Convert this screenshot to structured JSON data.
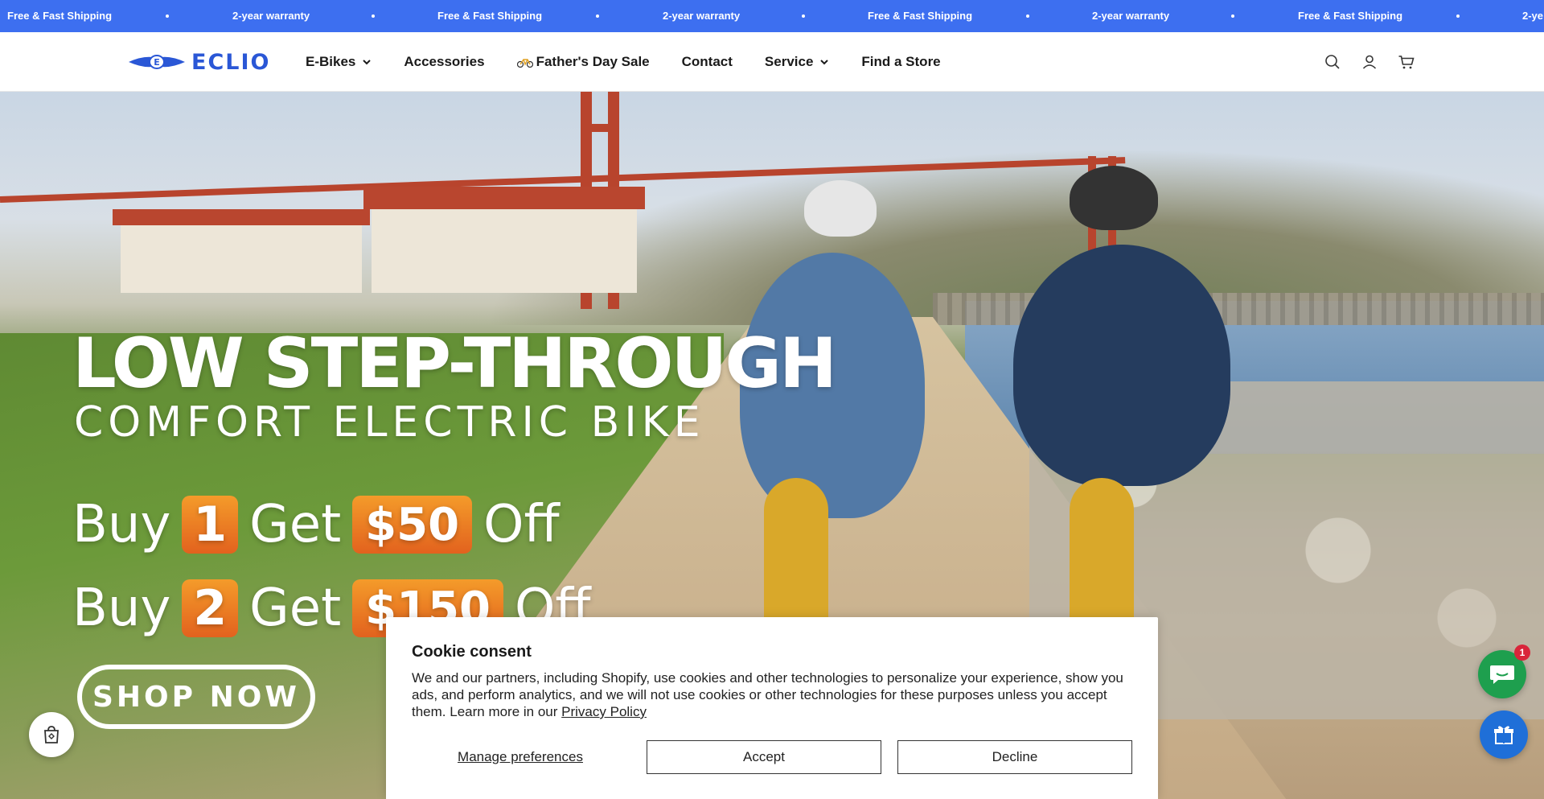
{
  "announcement": {
    "items": [
      "Free & Fast Shipping",
      "2-year warranty",
      "Free & Fast Shipping",
      "2-year warranty",
      "Free & Fast Shipping",
      "2-year warranty",
      "Free & Fast Shipping",
      "2-ye"
    ],
    "background": "#3d6ff0"
  },
  "header": {
    "logo_text": "ECLIO",
    "nav": [
      {
        "label": "E-Bikes",
        "has_dropdown": true
      },
      {
        "label": "Accessories",
        "has_dropdown": false
      },
      {
        "label": "Father's Day Sale",
        "has_dropdown": false,
        "icon": "bicycle-icon"
      },
      {
        "label": "Contact",
        "has_dropdown": false
      },
      {
        "label": "Service",
        "has_dropdown": true
      },
      {
        "label": "Find a Store",
        "has_dropdown": false
      }
    ],
    "icons": [
      "search-icon",
      "account-icon",
      "cart-icon"
    ]
  },
  "hero": {
    "title": "LOW STEP-THROUGH",
    "subtitle": "COMFORT ELECTRIC BIKE",
    "offer1": {
      "buy": "Buy",
      "qty": "1",
      "get": "Get",
      "amount": "$50",
      "off": "Off"
    },
    "offer2": {
      "buy": "Buy",
      "qty": "2",
      "get": "Get",
      "amount": "$150",
      "off": "Off"
    },
    "cta": "SHOP NOW",
    "badge_color": "#ef7d22"
  },
  "widgets": {
    "chat_badge_count": "1",
    "chat_color": "#1e9f4e",
    "gift_color": "#1f6fd8"
  },
  "cookie": {
    "title": "Cookie consent",
    "text": "We and our partners, including Shopify, use cookies and other technologies to personalize your experience, show you ads, and perform analytics, and we will not use cookies or other technologies for these purposes unless you accept them. Learn more in our ",
    "link_text": "Privacy Policy",
    "manage_label": "Manage preferences",
    "accept_label": "Accept",
    "decline_label": "Decline"
  }
}
